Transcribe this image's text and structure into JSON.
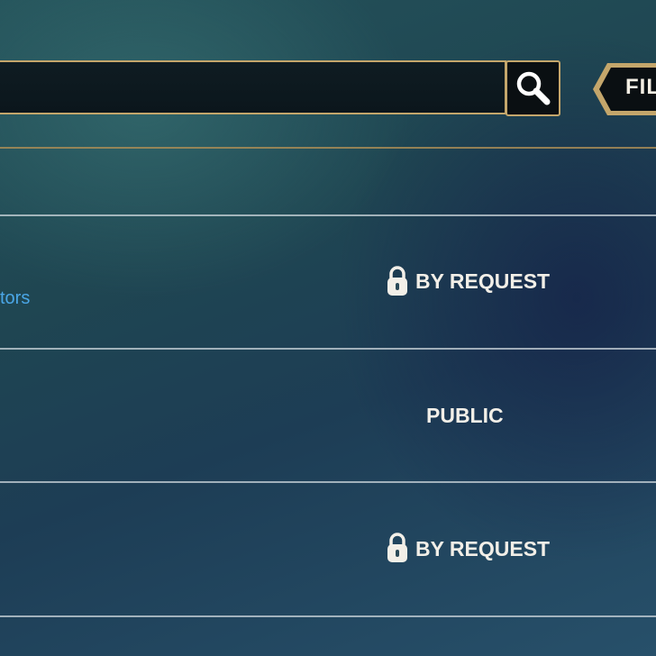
{
  "search": {
    "value": "",
    "placeholder": ""
  },
  "filter": {
    "label": "FIL"
  },
  "rows": [
    {
      "access": "BY REQUEST",
      "locked": true,
      "link": "tors"
    },
    {
      "access": "PUBLIC",
      "locked": false
    },
    {
      "access": "BY REQUEST",
      "locked": true
    }
  ],
  "colors": {
    "accent_gold": "#c4a66b",
    "link_blue": "#4aa6e6",
    "text_light": "#f2efe8",
    "search_bg": "#0f1c22"
  },
  "icons": {
    "search": "magnifier-icon",
    "lock": "padlock-icon"
  }
}
